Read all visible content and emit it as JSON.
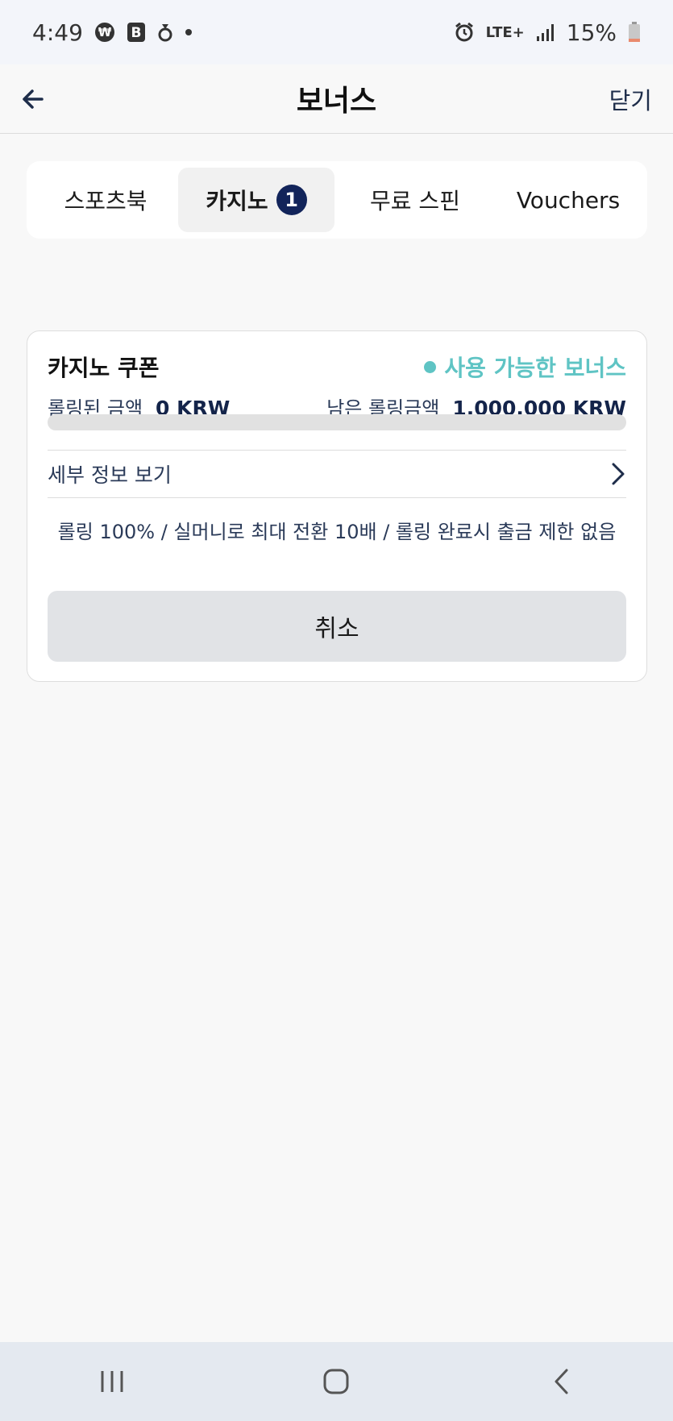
{
  "status_bar": {
    "time": "4:49",
    "battery": "15%",
    "network": "LTE+"
  },
  "header": {
    "title": "보너스",
    "close_label": "닫기"
  },
  "tabs": [
    {
      "label": "스포츠북"
    },
    {
      "label": "카지노",
      "badge": "1",
      "active": true
    },
    {
      "label": "무료 스핀"
    },
    {
      "label": "Vouchers"
    }
  ],
  "bonus_card": {
    "title": "카지노 쿠폰",
    "status": "사용 가능한 보너스",
    "rolled_label": "롤링된 금액",
    "rolled_amount": "0 KRW",
    "remaining_label": "남은 롤링금액",
    "remaining_amount": "1,000,000 KRW",
    "progress_fraction": 0,
    "details_label": "세부 정보 보기",
    "description": "롤링 100% / 실머니로 최대 전환 10배 / 롤링 완료시 출금 제한 없음",
    "cancel_label": "취소"
  },
  "colors": {
    "accent": "#5fc4c4",
    "badge_bg": "#12245a",
    "text_navy": "#14244a"
  }
}
